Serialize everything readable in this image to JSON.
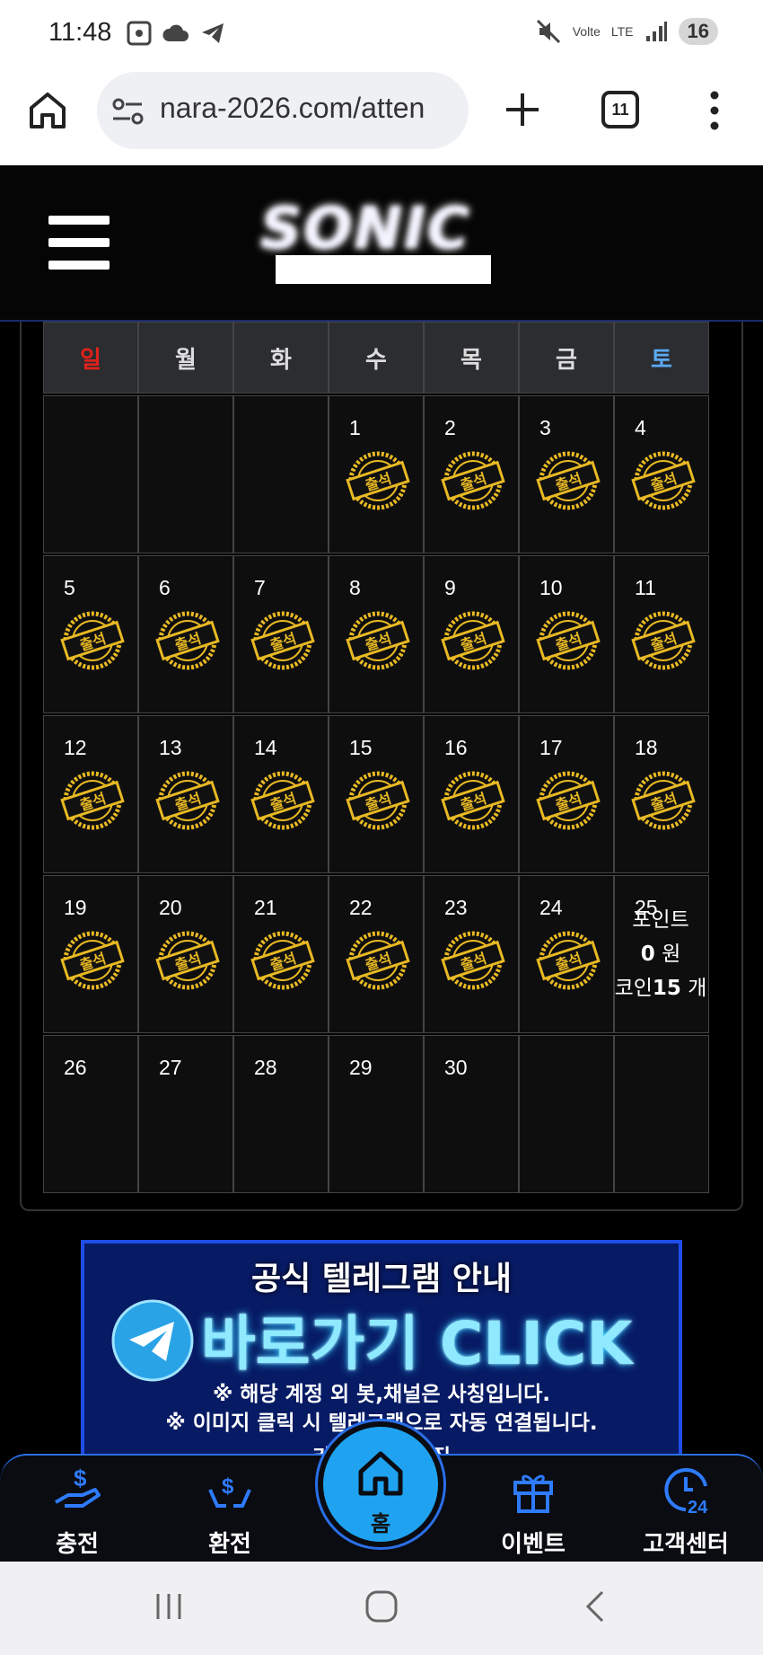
{
  "status_bar": {
    "time": "11:48",
    "network_label": "LTE",
    "volte_label": "Volte",
    "battery": "16"
  },
  "browser": {
    "url": "nara-2026.com/atten",
    "tab_count": "11"
  },
  "site": {
    "logo_text": "SONIC"
  },
  "calendar": {
    "weekdays": [
      "일",
      "월",
      "화",
      "수",
      "목",
      "금",
      "토"
    ],
    "stamp_label": "출석",
    "weeks": [
      [
        {
          "day": "",
          "attended": false
        },
        {
          "day": "",
          "attended": false
        },
        {
          "day": "",
          "attended": false
        },
        {
          "day": "1",
          "attended": true
        },
        {
          "day": "2",
          "attended": true
        },
        {
          "day": "3",
          "attended": true
        },
        {
          "day": "4",
          "attended": true
        }
      ],
      [
        {
          "day": "5",
          "attended": true
        },
        {
          "day": "6",
          "attended": true
        },
        {
          "day": "7",
          "attended": true
        },
        {
          "day": "8",
          "attended": true
        },
        {
          "day": "9",
          "attended": true
        },
        {
          "day": "10",
          "attended": true
        },
        {
          "day": "11",
          "attended": true
        }
      ],
      [
        {
          "day": "12",
          "attended": true
        },
        {
          "day": "13",
          "attended": true
        },
        {
          "day": "14",
          "attended": true
        },
        {
          "day": "15",
          "attended": true
        },
        {
          "day": "16",
          "attended": true
        },
        {
          "day": "17",
          "attended": true
        },
        {
          "day": "18",
          "attended": true
        }
      ],
      [
        {
          "day": "19",
          "attended": true
        },
        {
          "day": "20",
          "attended": true
        },
        {
          "day": "21",
          "attended": true
        },
        {
          "day": "22",
          "attended": true
        },
        {
          "day": "23",
          "attended": true
        },
        {
          "day": "24",
          "attended": true
        },
        {
          "day": "25",
          "attended": false
        }
      ],
      [
        {
          "day": "26",
          "attended": false
        },
        {
          "day": "27",
          "attended": false
        },
        {
          "day": "28",
          "attended": false
        },
        {
          "day": "29",
          "attended": false
        },
        {
          "day": "30",
          "attended": false
        },
        {
          "day": "",
          "attended": false
        },
        {
          "day": "",
          "attended": false
        }
      ]
    ],
    "points_popup": {
      "points_label": "포인트",
      "points_value": "0",
      "points_unit": "원",
      "coin_label": "코인",
      "coin_value": "15",
      "coin_unit": "개"
    }
  },
  "banner": {
    "title": "공식 텔레그램 안내",
    "cta": "바로가기 CLICK",
    "note1": "※ 해당 계정 외 봇,채널은 사칭입니다.",
    "note2": "※ 이미지 클릭 시 텔레그램으로 자동 연결됩니다.",
    "note3": "카지노 ... 모집"
  },
  "bottom_nav": {
    "items": [
      {
        "label": "충전",
        "icon": "deposit-icon"
      },
      {
        "label": "환전",
        "icon": "exchange-icon"
      },
      {
        "label": "홈",
        "icon": "home-icon"
      },
      {
        "label": "이벤트",
        "icon": "gift-icon"
      },
      {
        "label": "고객센터",
        "icon": "support-24-icon"
      }
    ]
  },
  "colors": {
    "accent_blue": "#1fa3f0",
    "stamp_gold": "#e8b923",
    "sunday_red": "#e0211a",
    "saturday_blue": "#5aaaf5"
  }
}
